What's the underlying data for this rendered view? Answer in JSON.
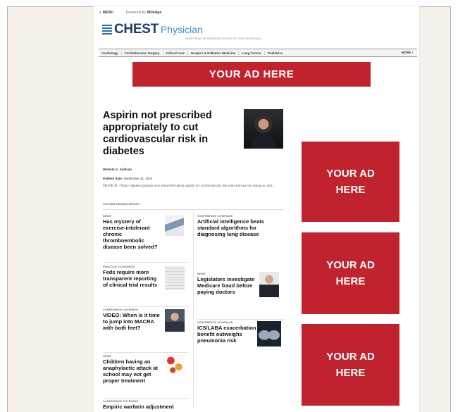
{
  "topbar": {
    "menu": "≡ MENU",
    "powered_by": "Powered by",
    "powered_brand": "MDedge"
  },
  "logo": {
    "chest": "CHEST",
    "physician": "Physician",
    "tagline": "NEWS FROM THE AMERICAN COLLEGE OF CHEST PHYSICIANS"
  },
  "nav": {
    "items": [
      "Cardiology",
      "Cardiothoracic Surgery",
      "Critical Care",
      "Hospice & Palliative Medicine",
      "Lung Cancer",
      "Pediatrics"
    ],
    "more": "MORE ›"
  },
  "ads": {
    "top": "YOUR AD HERE",
    "side": "YOUR AD HERE"
  },
  "featured": {
    "title": "Aspirin not prescribed appropriately to cut cardiovascular risk in diabetes",
    "byline": "Michele G. Sullivan",
    "date_label": "Publish date:",
    "date": "September 22, 2016",
    "teaser": "MUNICH – Many diabetes patients who should be taking aspirin for cardiovascular risk reduction are not doing so, and...",
    "continue": "CONTINUE READING ARTICLE ›"
  },
  "articles_left": [
    {
      "category": "NEWS",
      "title": "Has mystery of exercise-intolerant chronic thromboembolic disease been solved?"
    },
    {
      "category": "PRACTICE ECONOMICS",
      "title": "Feds require more transparent reporting of clinical trial results"
    },
    {
      "category": "CONFERENCE COVERAGE",
      "title": "VIDEO: When is it time to jump into MACRA with both feet?"
    },
    {
      "category": "NEWS",
      "title": "Children having an anaphylactic attack at school may not get proper treatment"
    },
    {
      "category": "CONFERENCE COVERAGE",
      "title": "Empiric warfarin adjustment"
    }
  ],
  "articles_right": [
    {
      "category": "CONFERENCE COVERAGE",
      "title": "Artificial intelligence beats standard algorithms for diagnosing lung disease"
    },
    {
      "category": "NEWS",
      "title": "Legislators investigate Medicare fraud before paying doctors"
    },
    {
      "category": "CONFERENCE COVERAGE",
      "title": "ICS/LABA exacerbation benefit outweighs pneumonia risk"
    }
  ],
  "colors": {
    "ad_red": "#c0232e",
    "logo_navy": "#1d3c6e",
    "logo_blue": "#3f8fcf"
  }
}
